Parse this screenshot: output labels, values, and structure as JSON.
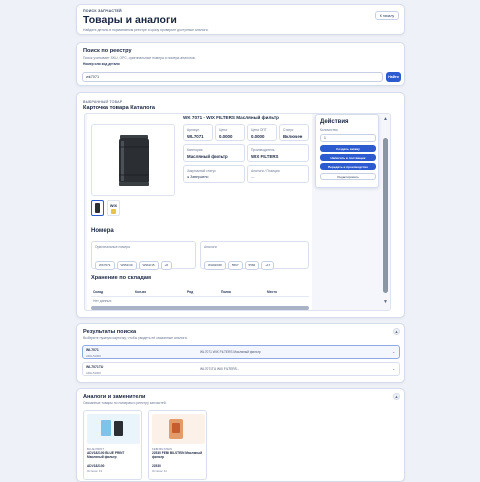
{
  "header": {
    "eyebrow": "ПОИСК ЗАПЧАСТЕЙ",
    "title": "Товары и аналоги",
    "subtitle": "Найдите деталь в нормативном реестре и сразу проверьте доступные аналоги.",
    "back_label": "К началу"
  },
  "search": {
    "title": "Поиск по реестру",
    "hint": "Поиск учитывает SKU, OPC, оригинальные номера и номера аналогов.",
    "field_label": "Номер или код детали",
    "value": "wk7071",
    "button": "Найти"
  },
  "product": {
    "eyebrow": "ВЫБРАННЫЙ ТОВАР",
    "title": "Карточка товара Каталога",
    "name": "WK 7071 - WIX FILTERS Масляный фильтр",
    "fields": [
      {
        "label": "Артикул",
        "value": "WL7071"
      },
      {
        "label": "Цена",
        "value": "0.0000"
      },
      {
        "label": "Цена ОПТ",
        "value": "0.0000"
      },
      {
        "label": "Статус",
        "value": "Включен"
      },
      {
        "label": "Категория",
        "value": "Масляный фильтр"
      },
      {
        "label": "Производитель",
        "value": "WIX FILTERS"
      },
      {
        "label": "Закупочный статус",
        "value": "Завершено"
      },
      {
        "label": "Аналоги / Позиции",
        "value": "—"
      }
    ],
    "thumb_logo": "WIX",
    "numbers_title": "Номера",
    "original_label": "Оригинальные номера",
    "original_chips": [
      "WK7071",
      "W952/49",
      "W962/15",
      "+8"
    ],
    "analog_label": "Аналоги",
    "analog_chips": [
      "WH9203R",
      "5567",
      "5566",
      "+17"
    ],
    "stock_title": "Хранение по складам",
    "stock_columns": [
      "Склад",
      "Кол-во",
      "Ряд",
      "Полка",
      "Место"
    ],
    "stock_empty": "Нет данных"
  },
  "actions": {
    "title": "Действия",
    "qty_label": "Количество",
    "qty_value": "1",
    "buttons": [
      "Создать заявку",
      "Написать в поставщик",
      "Передать в производство",
      "Редактировать"
    ]
  },
  "results": {
    "title": "Результаты поиска",
    "hint": "Выберите нужную карточку, чтобы увидеть её связанные аналоги.",
    "rows": [
      {
        "code": "WL7071",
        "sub": "ARG-51006",
        "desc": "WL7071 WIX FILTERS Масляный фильтр",
        "selected": true
      },
      {
        "code": "WL7071TU",
        "sub": "ARG-51006",
        "desc": "WL7071TU WIX FILTERS...",
        "selected": false
      }
    ]
  },
  "analogs": {
    "title": "Аналоги и заменители",
    "hint": "Связанные товары по номерам и реестру запчастей.",
    "items": [
      {
        "brand": "BLUE PRINT",
        "name": "ADV182100 BLUE PRINT Масляный фильтр",
        "code": "ADV182100",
        "stock": "Остаток: 13"
      },
      {
        "brand": "FEBI BILSTEIN",
        "name": "22530 FEBI BILSTEIN Масляный фильтр",
        "code": "22530",
        "stock": "Остаток: 11"
      }
    ]
  },
  "colors": {
    "accent": "#2c5bd0",
    "background": "#eef1f7",
    "text": "#1d2a44"
  }
}
